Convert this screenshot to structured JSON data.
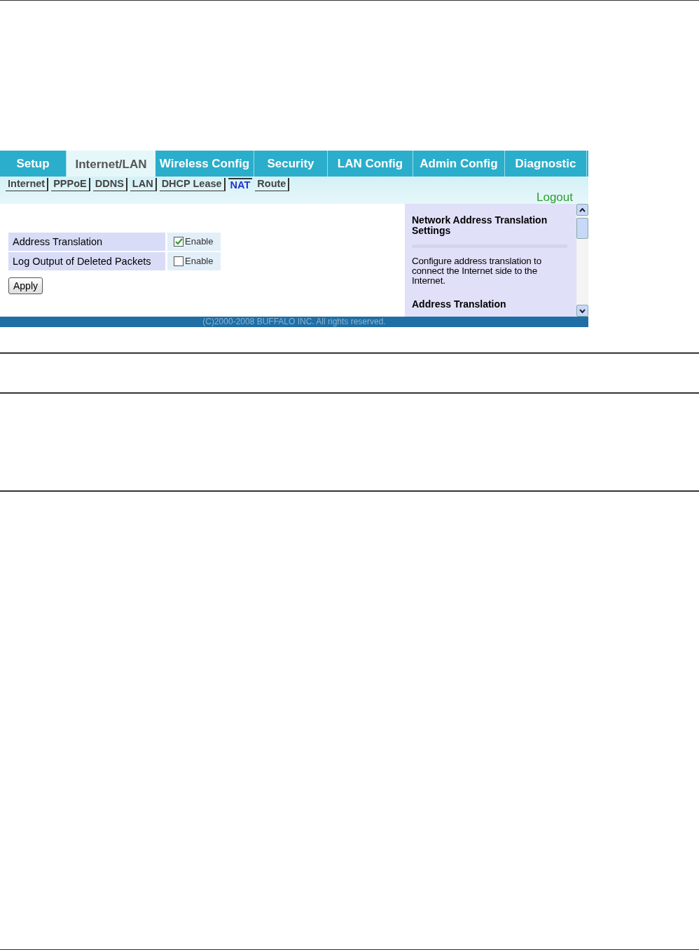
{
  "tabs": [
    {
      "label": "Setup",
      "selected": false
    },
    {
      "label": "Internet/LAN",
      "selected": true
    },
    {
      "label": "Wireless Config",
      "selected": false
    },
    {
      "label": "Security",
      "selected": false
    },
    {
      "label": "LAN Config",
      "selected": false
    },
    {
      "label": "Admin Config",
      "selected": false
    },
    {
      "label": "Diagnostic",
      "selected": false
    }
  ],
  "subtabs": [
    {
      "label": "Internet",
      "selected": false
    },
    {
      "label": "PPPoE",
      "selected": false
    },
    {
      "label": "DDNS",
      "selected": false
    },
    {
      "label": "LAN",
      "selected": false
    },
    {
      "label": "DHCP Lease",
      "selected": false
    },
    {
      "label": "NAT",
      "selected": true
    },
    {
      "label": "Route",
      "selected": false
    }
  ],
  "logout": "Logout",
  "settings": [
    {
      "label": "Address Translation",
      "option": "Enable",
      "checked": true
    },
    {
      "label": "Log Output of Deleted Packets",
      "option": "Enable",
      "checked": false
    }
  ],
  "apply_button": "Apply",
  "help": {
    "title": "Network Address Translation Settings",
    "text": "Configure address translation to connect the Internet side to the Internet.",
    "heading": "Address Translation"
  },
  "footer": "(C)2000-2008 BUFFALO INC. All rights reserved."
}
